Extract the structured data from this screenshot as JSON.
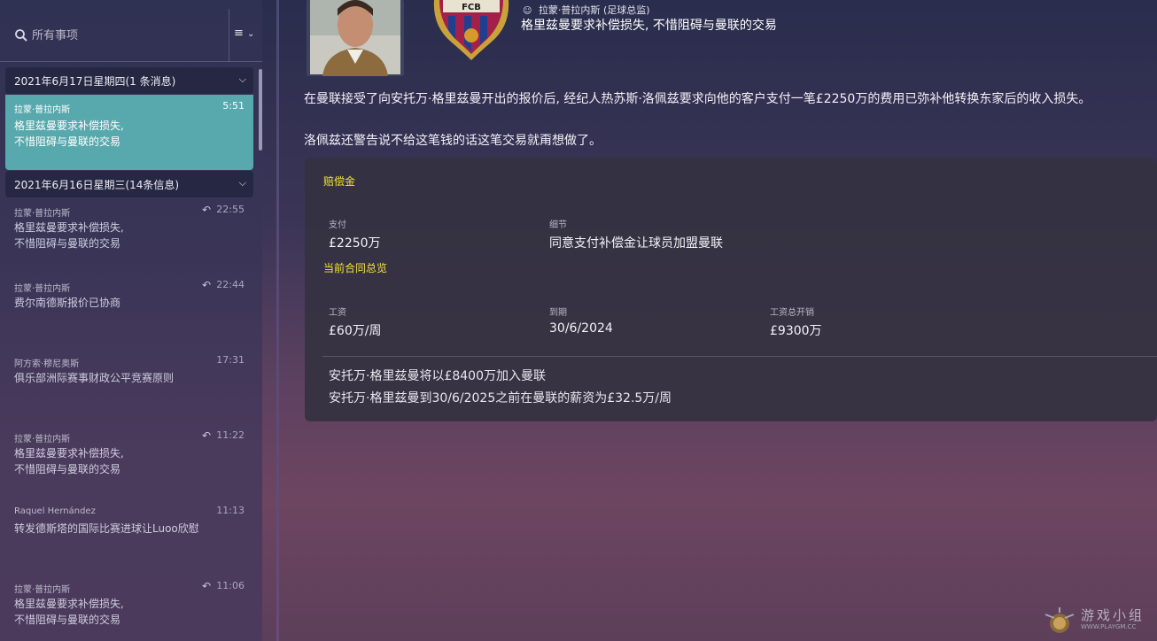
{
  "search": {
    "placeholder": "所有事项",
    "filter_label": "≡"
  },
  "groups": [
    {
      "date": "2021年6月17日星期四(1 条消息)"
    },
    {
      "date": "2021年6月16日星期三(14条信息)"
    }
  ],
  "selected_message": {
    "sender": "拉蒙·普拉内斯",
    "time": "5:51",
    "subject_line1": "格里兹曼要求补偿损失,",
    "subject_line2": "不惜阻碍与曼联的交易"
  },
  "messages": [
    {
      "sender": "拉蒙·普拉内斯",
      "time": "22:55",
      "replied": true,
      "line1": "格里兹曼要求补偿损失,",
      "line2": "不惜阻碍与曼联的交易"
    },
    {
      "sender": "拉蒙·普拉内斯",
      "time": "22:44",
      "replied": true,
      "line1": "费尔南德斯报价已协商",
      "line2": ""
    },
    {
      "sender": "阿方索·穆尼奥斯",
      "time": "17:31",
      "replied": false,
      "line1": "俱乐部洲际赛事财政公平竞赛原则",
      "line2": ""
    },
    {
      "sender": "拉蒙·普拉内斯",
      "time": "11:22",
      "replied": true,
      "line1": "格里兹曼要求补偿损失,",
      "line2": "不惜阻碍与曼联的交易"
    },
    {
      "sender": "Raquel Hernández",
      "time": "11:13",
      "replied": false,
      "line1": "转发德斯塔的国际比赛进球让Luoo欣慰",
      "line2": ""
    },
    {
      "sender": "拉蒙·普拉内斯",
      "time": "11:06",
      "replied": true,
      "line1": "格里兹曼要求补偿损失,",
      "line2": "不惜阻碍与曼联的交易"
    }
  ],
  "reply_glyph": "↶",
  "header": {
    "from_name": "拉蒙·普拉内斯",
    "from_role": "(足球总监)",
    "headline": "格里兹曼要求补偿损失, 不惜阻碍与曼联的交易",
    "crest_text": "FCB"
  },
  "body": {
    "p1": "在曼联接受了向安托万·格里兹曼开出的报价后, 经纪人热苏斯·洛佩兹要求向他的客户支付一笔£2250万的费用已弥补他转换东家后的收入损失。",
    "p2": "洛佩兹还警告说不给这笔钱的话这笔交易就甭想做了。"
  },
  "card": {
    "compensation_title": "赔偿金",
    "pay_label": "支付",
    "pay_value": "£2250万",
    "detail_label": "细节",
    "detail_value": "同意支付补偿金让球员加盟曼联",
    "contract_title": "当前合同总览",
    "wage_label": "工资",
    "wage_value": "£60万/周",
    "expiry_label": "到期",
    "expiry_value": "30/6/2024",
    "total_label": "工资总开销",
    "total_value": "£9300万",
    "note1": "安托万·格里兹曼将以£8400万加入曼联",
    "note2": "安托万·格里兹曼到30/6/2025之前在曼联的薪资为£32.5万/周"
  },
  "watermark": {
    "title": "游戏小组",
    "url": "WWW.PLAYGM.CC"
  },
  "colors": {
    "accent_yellow": "#f3e23a",
    "selected_teal": "#58a9ad"
  }
}
